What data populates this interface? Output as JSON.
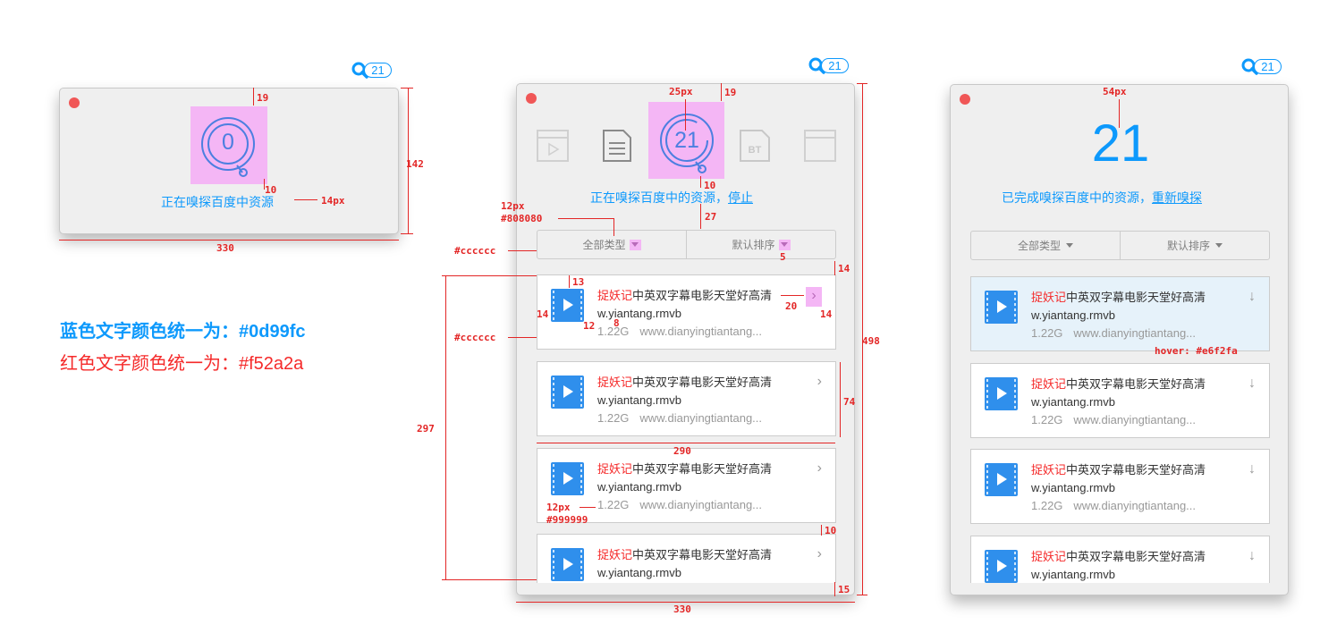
{
  "colors": {
    "blue": "#0d99fc",
    "red": "#f52a2a",
    "border": "#cccccc",
    "hover": "#e6f2fa",
    "meta": "#999999",
    "filter_text": "#808080"
  },
  "badge_count": "21",
  "panel1": {
    "count": "0",
    "status": "正在嗅探百度中资源"
  },
  "panel2": {
    "count": "21",
    "status_prefix": "正在嗅探百度中的资源，",
    "status_link": "停止",
    "filter_type": "全部类型",
    "filter_sort": "默认排序",
    "type_icons": [
      "film-icon",
      "document-icon",
      "bt-icon",
      "window-icon"
    ],
    "type_icon_bt_label": "BT"
  },
  "panel3": {
    "count": "21",
    "status_prefix": "已完成嗅探百度中的资源，",
    "status_link": "重新嗅探",
    "filter_type": "全部类型",
    "filter_sort": "默认排序"
  },
  "item": {
    "title_red": "捉妖记",
    "title_rest": "中英双字幕电影天堂好高清",
    "title_line2": "w.yiantang.rmvb",
    "size": "1.22G",
    "source": "www.dianyingtiantang..."
  },
  "notes": {
    "blue": "蓝色文字颜色统一为：#0d99fc",
    "red": "红色文字颜色统一为：#f52a2a"
  },
  "annotations": {
    "p1_top": "19",
    "p1_gap": "10",
    "p1_font": "14px",
    "p1_height": "142",
    "p1_width": "330",
    "p2_icon": "25px",
    "p2_top": "19",
    "p2_gap": "10",
    "p2_gap2": "27",
    "p2_font": "12px",
    "p2_font_color": "#808080",
    "p2_border": "#cccccc",
    "p2_caret": "5",
    "p2_gap3": "14",
    "p2_item_top": "13",
    "p2_icon_left": "14",
    "p2_icon_gap": "12",
    "p2_line": "8",
    "p2_action": "20",
    "p2_action_right": "14",
    "p2_item_border": "#cccccc",
    "p2_item_h": "74",
    "p2_item_w": "290",
    "p2_list_h": "297",
    "p2_meta_font": "12px",
    "p2_meta_color": "#999999",
    "p2_item_gap": "10",
    "p2_bottom": "15",
    "p2_height": "498",
    "p2_width": "330",
    "p3_font": "54px",
    "p3_hover": "hover: #e6f2fa"
  }
}
